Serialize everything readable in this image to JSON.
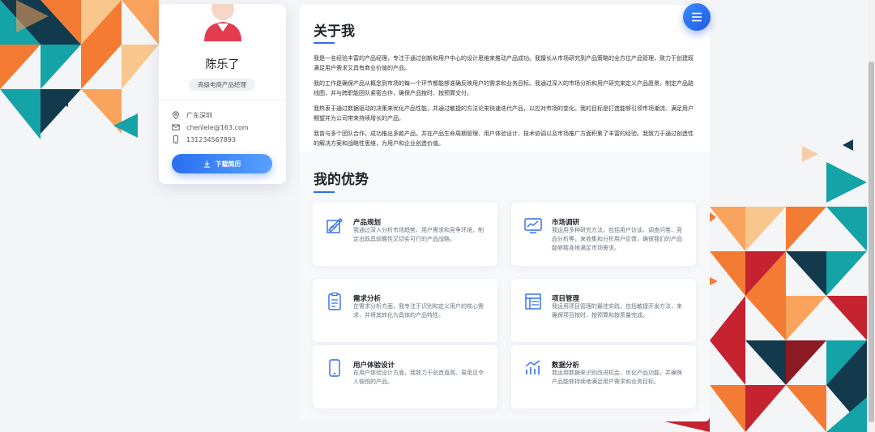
{
  "profile": {
    "name": "陈乐了",
    "title": "高级电商产品经理",
    "location": "广东深圳",
    "email": "chenlele@163.com",
    "phone": "131234567893",
    "download_label": "下载简历"
  },
  "about": {
    "title": "关于我",
    "paragraphs": [
      "我是一名经验丰富的产品经理，专注于通过创新和用户中心的设计思维来推动产品成功。我擅长从市场研究到产品策略的全方位产品管理，致力于创建既满足用户需求又具有商业价值的产品。",
      "我的工作是确保产品从概念到市场的每一个环节都能够准确反映用户的需求和业务目标。我通过深入的市场分析和用户研究来定义产品愿景，制定产品路线图，并与跨职能团队紧密合作，确保产品按时、按预算交付。",
      "我热衷于通过数据驱动的决策来优化产品性能，并通过敏捷的方法论来快速迭代产品，以应对市场的变化。我的目标是打造能够引领市场潮流、满足用户期望并为公司带来持续增长的产品。",
      "我曾与多个团队合作，成功推出多款产品，并在产品生命周期管理、用户体验设计、技术协调以及市场推广方面积累了丰富的经验。我致力于通过创造性的解决方案和战略性思维，为用户和企业创造价值。"
    ]
  },
  "advantages": {
    "title": "我的优势",
    "cards": [
      {
        "icon": "product-planning-icon",
        "title": "产品规划",
        "desc": "我通过深入分析市场趋势、用户需求和竞争环境，制定出既具前瞻性又切实可行的产品战略。"
      },
      {
        "icon": "market-research-icon",
        "title": "市场调研",
        "desc": "我运用多种研究方法，包括用户访谈、调查问卷、竞品分析等，来收集和分析用户反馈，确保我们的产品能够精准地满足市场需求。"
      },
      {
        "icon": "requirements-analysis-icon",
        "title": "需求分析",
        "desc": "在需求分析方面，我专注于识别和定义用户的核心需求，并将其转化为具体的产品特性。"
      },
      {
        "icon": "project-management-icon",
        "title": "项目管理",
        "desc": "我运用项目管理的最佳实践，包括敏捷开发方法，来确保项目按时、按预算和按质量完成。"
      },
      {
        "icon": "ux-design-icon",
        "title": "用户体验设计",
        "desc": "在用户体验设计方面，我致力于创造直观、易用且令人愉悦的产品。"
      },
      {
        "icon": "data-analysis-icon",
        "title": "数据分析",
        "desc": "我运用数据来识别改进机会，优化产品功能，并确保产品能够持续地满足用户需求和业务目标。"
      }
    ]
  },
  "colors": {
    "accent": "#2f6df0",
    "bg_teal": "#14a3a7",
    "bg_navy": "#123a4c",
    "bg_orange": "#f37b34",
    "bg_red": "#c4232f"
  }
}
